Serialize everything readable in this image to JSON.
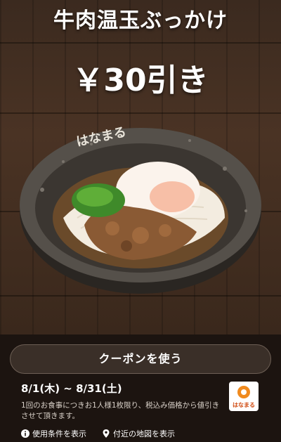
{
  "title": "牛肉温玉ぶっかけ",
  "price_label": "￥30引き",
  "use_button": "クーポンを使う",
  "valid_period": "8/1(木) ~ 8/31(土)",
  "terms": "1回のお食事につきお1人様1枚限り、税込み価格から値引きさせて頂きます。",
  "links": {
    "conditions": "使用条件を表示",
    "nearby_map": "付近の地図を表示"
  },
  "brand_text": "はなまる",
  "colors": {
    "accent_orange": "#f08a1e",
    "background": "#1c1410"
  }
}
